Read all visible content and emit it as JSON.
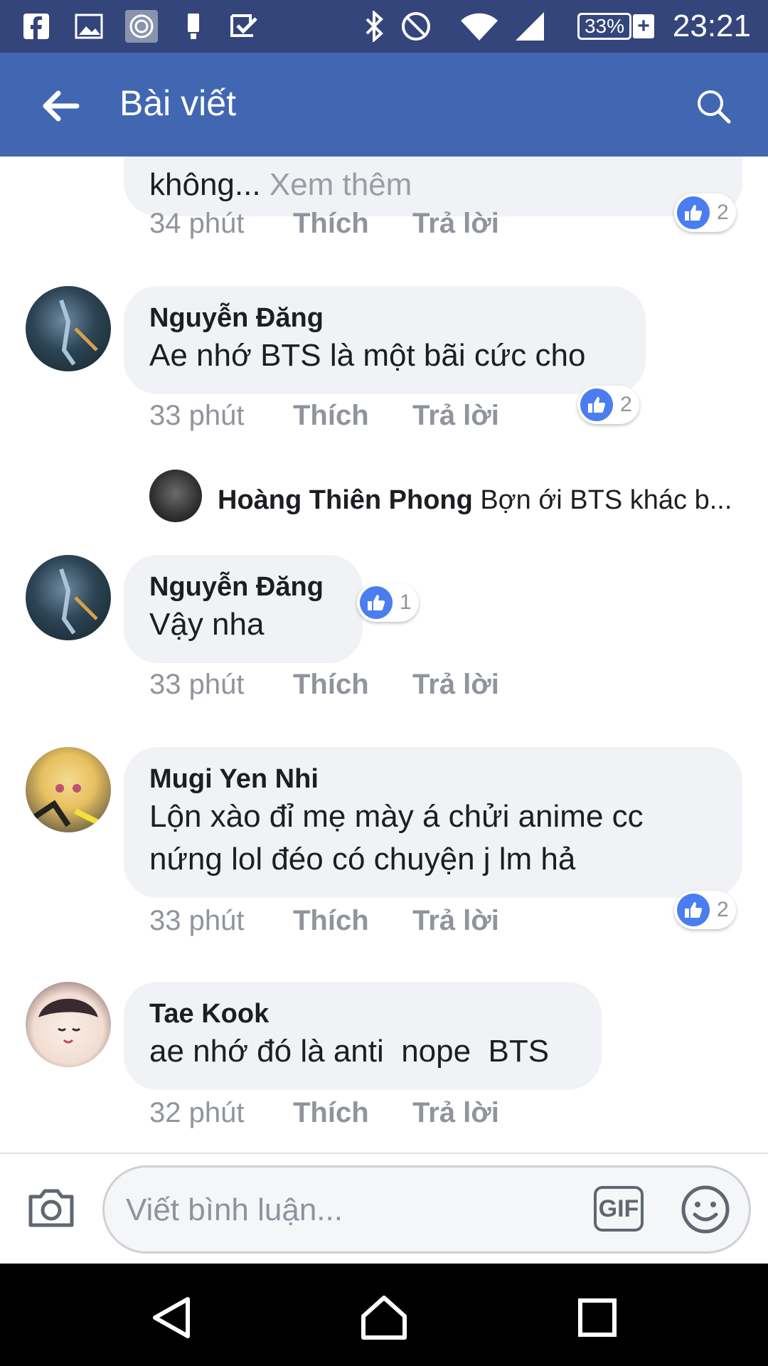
{
  "status_bar": {
    "battery": "33%",
    "charging_mark": "+",
    "time": "23:21"
  },
  "app_bar": {
    "title": "Bài viết"
  },
  "comments": [
    {
      "text_tail": "không...",
      "more": "Xem thêm",
      "time": "34 phút",
      "like_label": "Thích",
      "reply_label": "Trả lời",
      "like_count": "2"
    },
    {
      "author": "Nguyễn Đăng",
      "text": "Ae nhớ BTS là một bãi cức cho",
      "time": "33 phút",
      "like_label": "Thích",
      "reply_label": "Trả lời",
      "like_count": "2"
    },
    {
      "author": "Nguyễn Đăng",
      "text": "Vậy nha",
      "time": "33 phút",
      "like_label": "Thích",
      "reply_label": "Trả lời",
      "like_count": "1"
    },
    {
      "author": "Mugi Yen Nhi",
      "text_line1": "Lộn xào đỉ mẹ mày á chửi anime cc",
      "text_line2": "nứng lol đéo có chuyện j lm hả",
      "time": "33 phút",
      "like_label": "Thích",
      "reply_label": "Trả lời",
      "like_count": "2"
    },
    {
      "author": "Tae Kook",
      "text": "ae nhớ đó là anti  nope  BTS",
      "time": "32 phút",
      "like_label": "Thích",
      "reply_label": "Trả lời"
    }
  ],
  "reply_preview": {
    "author": "Hoàng Thiên Phong",
    "text": "Bợn ới BTS khác b..."
  },
  "composer": {
    "placeholder": "Viết bình luận...",
    "gif_label": "GIF"
  },
  "icons": {
    "status": [
      "facebook-icon",
      "image-icon",
      "camera-lens-icon",
      "phone-usb-icon",
      "checkmark-icon",
      "bluetooth-icon",
      "no-disturb-icon",
      "wifi-icon",
      "signal-icon",
      "battery-icon"
    ],
    "app_bar": [
      "back-arrow-icon",
      "search-icon"
    ],
    "composer": [
      "camera-icon",
      "gif-icon",
      "emoji-icon"
    ],
    "nav": [
      "back-triangle-icon",
      "home-icon",
      "recents-icon"
    ]
  },
  "colors": {
    "status_bar": "#34457b",
    "app_bar": "#4267b2",
    "bubble": "#f0f2f5",
    "like_blue": "#4a7df0",
    "meta_gray": "#90949c"
  }
}
